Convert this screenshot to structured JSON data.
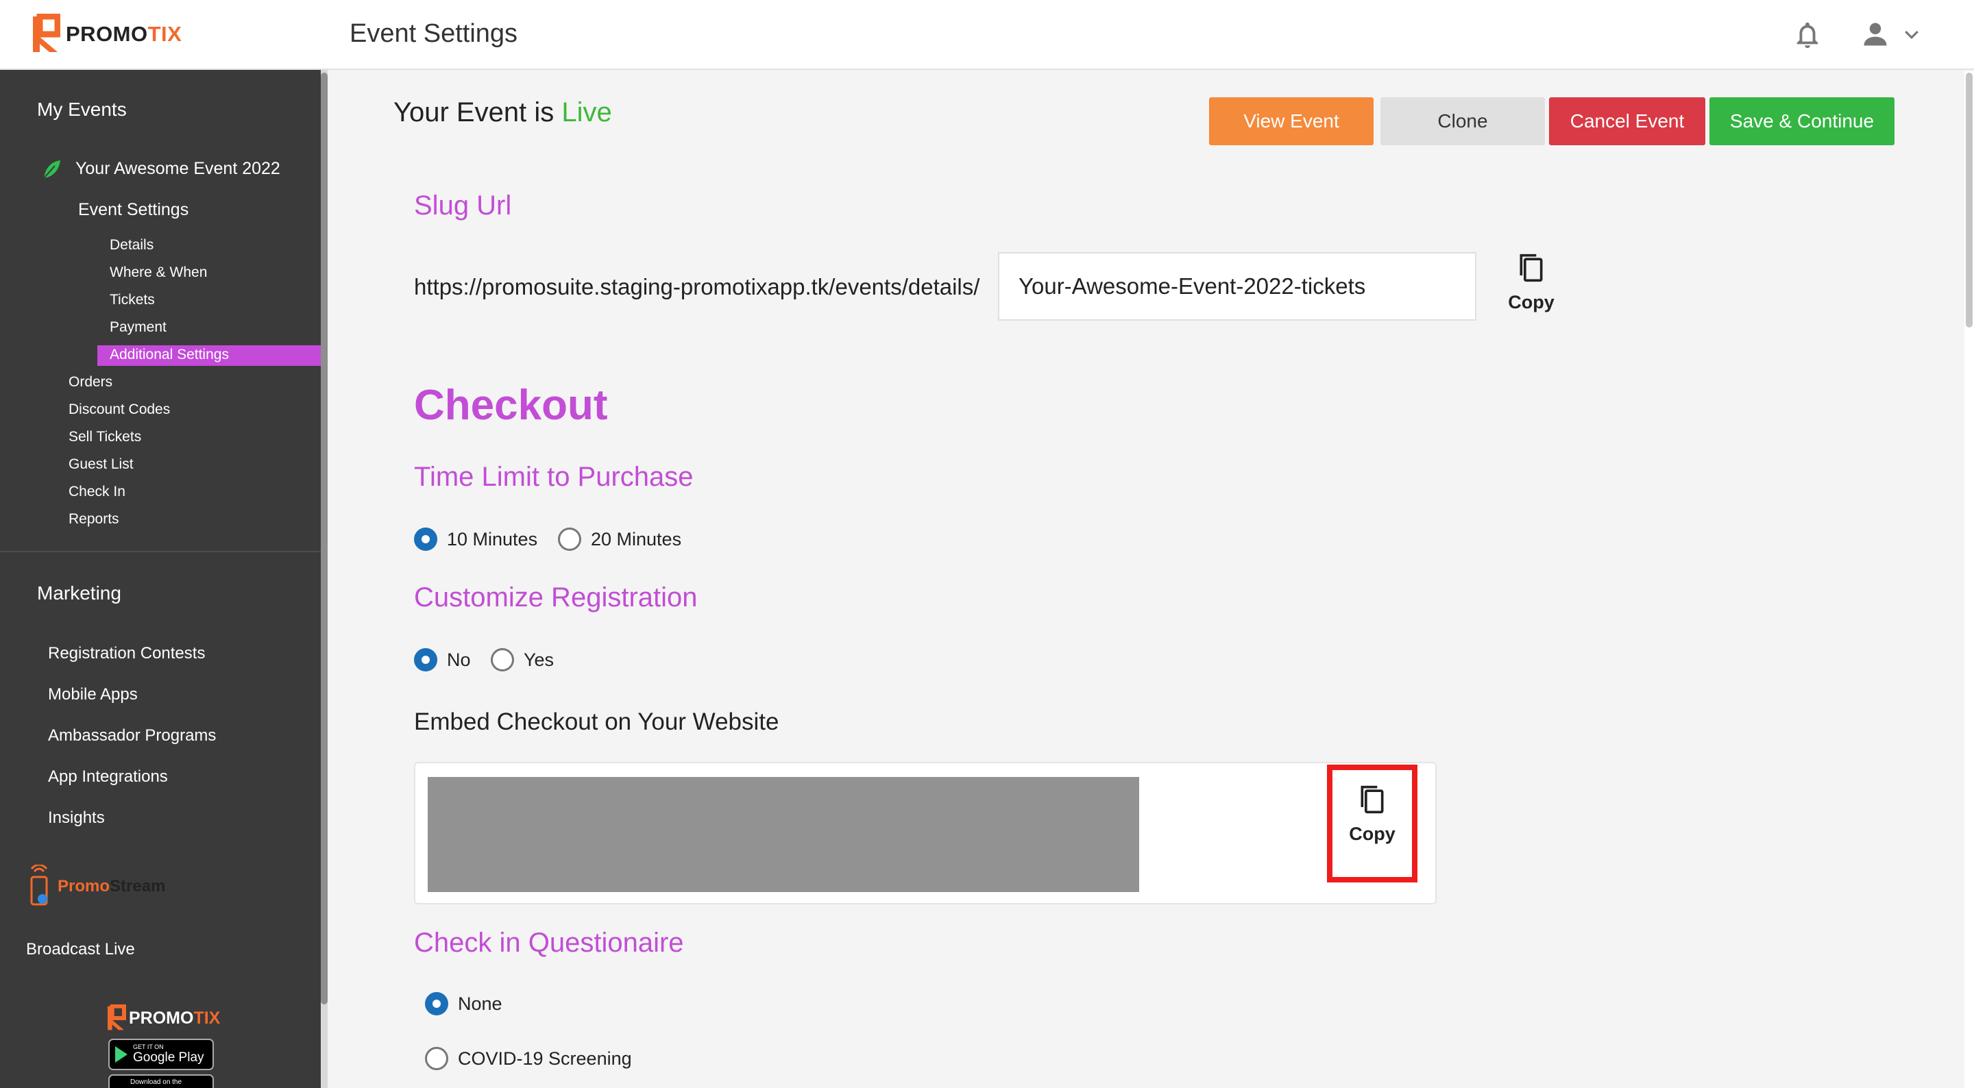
{
  "header": {
    "logo": {
      "promo": "PROMO",
      "tix": "TIX"
    },
    "title": "Event Settings"
  },
  "sidebar": {
    "my_events": "My Events",
    "event_name": "Your Awesome Event 2022",
    "event_settings": "Event Settings",
    "settings_items": [
      "Details",
      "Where & When",
      "Tickets",
      "Payment",
      "Additional Settings"
    ],
    "active_item": "Additional Settings",
    "event_items": [
      "Orders",
      "Discount Codes",
      "Sell Tickets",
      "Guest List",
      "Check In",
      "Reports"
    ],
    "marketing": "Marketing",
    "marketing_items": [
      "Registration Contests",
      "Mobile Apps",
      "Ambassador Programs",
      "App Integrations",
      "Insights"
    ],
    "promostream": {
      "promo": "Promo",
      "stream": "Stream"
    },
    "broadcast": "Broadcast Live",
    "footer_logo": {
      "promo": "PROMO",
      "tix": "TIX"
    },
    "google_play": {
      "small": "GET IT ON",
      "big": "Google Play"
    },
    "app_store": {
      "small": "Download on the"
    }
  },
  "main": {
    "status_prefix": "Your Event is ",
    "status_value": "Live",
    "buttons": {
      "view": "View Event",
      "clone": "Clone",
      "cancel": "Cancel Event",
      "save": "Save & Continue"
    },
    "slug": {
      "title": "Slug Url",
      "prefix": "https://promosuite.staging-promotixapp.tk/events/details/",
      "value": "Your-Awesome-Event-2022-tickets",
      "copy_label": "Copy"
    },
    "checkout_title": "Checkout",
    "time_limit": {
      "title": "Time Limit to Purchase",
      "options": [
        "10 Minutes",
        "20 Minutes"
      ],
      "selected": "10 Minutes"
    },
    "customize_registration": {
      "title": "Customize Registration",
      "options": [
        "No",
        "Yes"
      ],
      "selected": "No"
    },
    "embed": {
      "title": "Embed Checkout on Your Website",
      "copy_label": "Copy"
    },
    "checkin_questionnaire": {
      "title": "Check in Questionaire",
      "options": [
        "None",
        "COVID-19 Screening"
      ],
      "selected": "None"
    }
  },
  "colors": {
    "accent_purple": "#c24dd6",
    "live_green": "#3db83a",
    "view_orange": "#f48a3b",
    "cancel_red": "#d93a45",
    "save_green": "#35b544",
    "sidebar_bg": "#3a3a3a",
    "highlight_red": "#ee1c1c"
  }
}
